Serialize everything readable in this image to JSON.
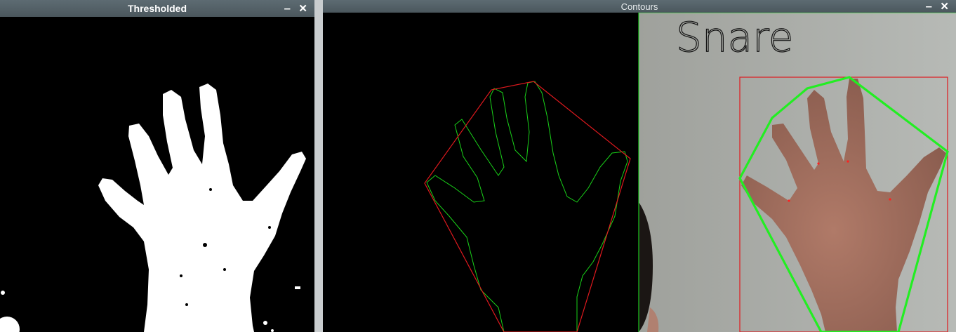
{
  "windows": {
    "thresholded": {
      "title": "Thresholded",
      "minimize": "‒",
      "close": "✕"
    },
    "contours": {
      "title": "Contours",
      "minimize": "‒",
      "close": "✕"
    }
  },
  "detection": {
    "gesture_label": "Snare"
  },
  "colors": {
    "contour": "#19d219",
    "hull": "#e0191e",
    "hull_thick": "#22ee22",
    "defect": "#ff2020",
    "mask": "#ffffff",
    "titlebar": "#55636a"
  }
}
